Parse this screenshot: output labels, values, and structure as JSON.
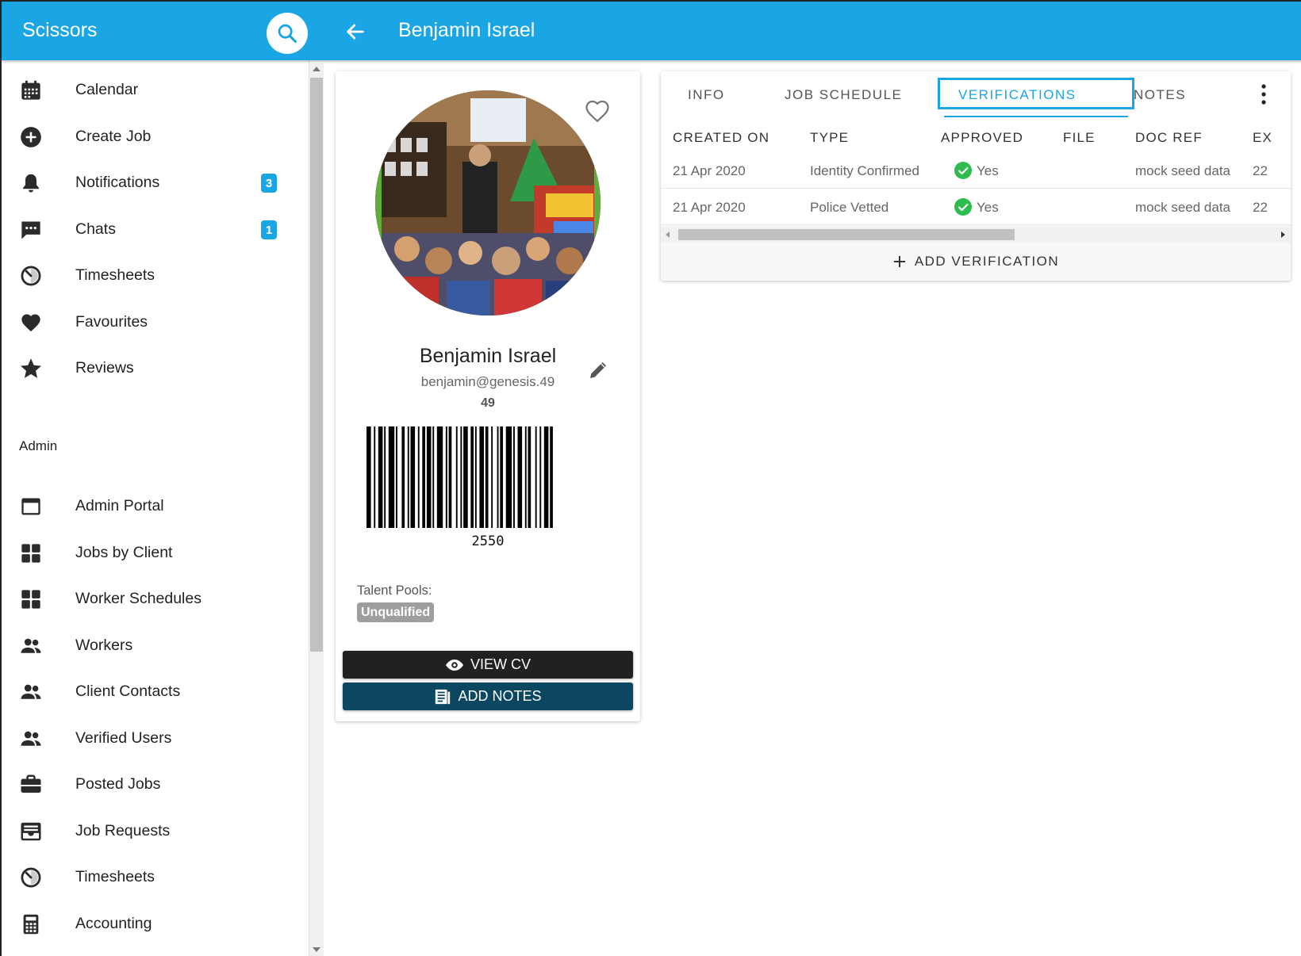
{
  "app": {
    "title": "Scissors"
  },
  "header": {
    "title": "Benjamin Israel"
  },
  "sidebar": {
    "items": [
      {
        "label": "Calendar",
        "icon": "calendar-icon"
      },
      {
        "label": "Create Job",
        "icon": "add-circle-icon"
      },
      {
        "label": "Notifications",
        "icon": "bell-icon",
        "badge": "3"
      },
      {
        "label": "Chats",
        "icon": "chat-icon",
        "badge": "1"
      },
      {
        "label": "Timesheets",
        "icon": "timer-icon"
      },
      {
        "label": "Favourites",
        "icon": "heart-icon"
      },
      {
        "label": "Reviews",
        "icon": "star-icon"
      }
    ],
    "admin_title": "Admin",
    "admin_items": [
      {
        "label": "Admin Portal",
        "icon": "window-icon"
      },
      {
        "label": "Jobs by Client",
        "icon": "grid-icon"
      },
      {
        "label": "Worker Schedules",
        "icon": "grid-icon"
      },
      {
        "label": "Workers",
        "icon": "people-icon"
      },
      {
        "label": "Client Contacts",
        "icon": "people-icon"
      },
      {
        "label": "Verified Users",
        "icon": "people-icon"
      },
      {
        "label": "Posted Jobs",
        "icon": "briefcase-icon"
      },
      {
        "label": "Job Requests",
        "icon": "inbox-icon"
      },
      {
        "label": "Timesheets",
        "icon": "timer-icon"
      },
      {
        "label": "Accounting",
        "icon": "calculator-icon"
      }
    ]
  },
  "profile": {
    "name": "Benjamin Israel",
    "email": "benjamin@genesis.49",
    "id": "49",
    "barcode_number": "2550",
    "talent_pools_label": "Talent Pools:",
    "talent_pool": "Unqualified",
    "view_cv_label": "VIEW CV",
    "add_notes_label": "ADD NOTES"
  },
  "tabs": [
    {
      "label": "INFO",
      "active": false
    },
    {
      "label": "JOB SCHEDULE",
      "active": false
    },
    {
      "label": "VERIFICATIONS",
      "active": true
    },
    {
      "label": "NOTES",
      "active": false
    }
  ],
  "table": {
    "columns": [
      "CREATED ON",
      "TYPE",
      "APPROVED",
      "FILE",
      "DOC REF",
      "EX"
    ],
    "rows": [
      {
        "created_on": "21 Apr 2020",
        "type": "Identity Confirmed",
        "approved": "Yes",
        "file": "",
        "doc_ref": "mock seed data",
        "expiry": "22"
      },
      {
        "created_on": "21 Apr 2020",
        "type": "Police Vetted",
        "approved": "Yes",
        "file": "",
        "doc_ref": "mock seed data",
        "expiry": "22"
      }
    ]
  },
  "add_verification_label": "ADD VERIFICATION",
  "colors": {
    "primary": "#1aa6e4",
    "dark_button": "#212121",
    "notes_button": "#0c4762",
    "approved": "#2ebc4f",
    "chip": "#9e9e9e"
  }
}
